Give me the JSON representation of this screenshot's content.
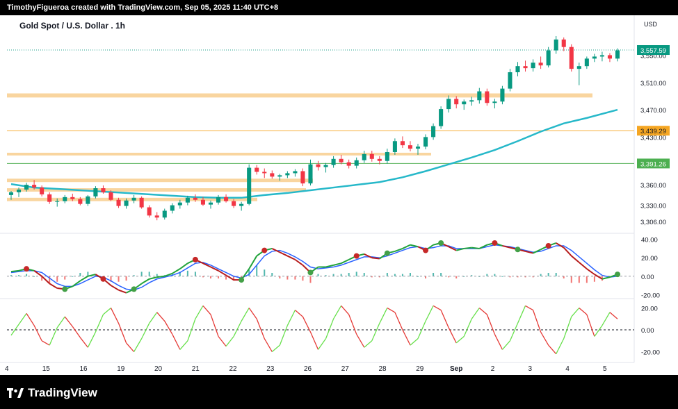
{
  "header": {
    "caption": "TimothyFigueroa created with TradingView.com, Sep 05, 2025 11:40 UTC+8"
  },
  "brand": {
    "name": "TradingView"
  },
  "chart_data": {
    "type": "candlestick",
    "title": "Gold Spot / U.S. Dollar . 1h",
    "currency": "USD",
    "x_labels": [
      "4",
      "15",
      "16",
      "19",
      "20",
      "21",
      "22",
      "23",
      "26",
      "27",
      "28",
      "29",
      "Sep",
      "2",
      "3",
      "4",
      "5"
    ],
    "y_ticks": [
      "3,550.00",
      "3,510.00",
      "3,470.00",
      "3,430.00",
      "3,390.00",
      "3,360.00",
      "3,330.00",
      "3,306.00"
    ],
    "ylim": [
      3295,
      3580
    ],
    "price_labels": [
      {
        "value": 3557.59,
        "text": "3,557.59",
        "color": "#089981"
      },
      {
        "value": 3439.29,
        "text": "3,439.29",
        "color": "#f5a623"
      },
      {
        "value": 3391.26,
        "text": "3,391.26",
        "color": "#4caf50"
      }
    ],
    "zones": [
      {
        "from": 3488,
        "to": 3494
      },
      {
        "from": 3403,
        "to": 3407
      },
      {
        "from": 3364,
        "to": 3369
      },
      {
        "from": 3350,
        "to": 3355
      },
      {
        "from": 3336,
        "to": 3341
      }
    ],
    "candles": [
      [
        3345,
        3351,
        3338,
        3349
      ],
      [
        3349,
        3356,
        3342,
        3353
      ],
      [
        3353,
        3363,
        3350,
        3360
      ],
      [
        3360,
        3367,
        3353,
        3356
      ],
      [
        3356,
        3359,
        3343,
        3346
      ],
      [
        3346,
        3349,
        3332,
        3335
      ],
      [
        3335,
        3340,
        3328,
        3336
      ],
      [
        3336,
        3345,
        3333,
        3342
      ],
      [
        3342,
        3347,
        3336,
        3339
      ],
      [
        3339,
        3342,
        3330,
        3332
      ],
      [
        3332,
        3345,
        3329,
        3343
      ],
      [
        3343,
        3358,
        3340,
        3355
      ],
      [
        3355,
        3359,
        3347,
        3349
      ],
      [
        3349,
        3352,
        3336,
        3338
      ],
      [
        3338,
        3341,
        3326,
        3329
      ],
      [
        3329,
        3340,
        3325,
        3337
      ],
      [
        3337,
        3345,
        3333,
        3341
      ],
      [
        3341,
        3343,
        3325,
        3327
      ],
      [
        3327,
        3330,
        3312,
        3315
      ],
      [
        3315,
        3320,
        3308,
        3312
      ],
      [
        3312,
        3325,
        3309,
        3322
      ],
      [
        3322,
        3333,
        3318,
        3330
      ],
      [
        3330,
        3338,
        3325,
        3334
      ],
      [
        3334,
        3344,
        3330,
        3341
      ],
      [
        3341,
        3346,
        3335,
        3338
      ],
      [
        3338,
        3342,
        3329,
        3331
      ],
      [
        3331,
        3337,
        3325,
        3334
      ],
      [
        3334,
        3345,
        3331,
        3342
      ],
      [
        3342,
        3346,
        3334,
        3336
      ],
      [
        3336,
        3339,
        3326,
        3329
      ],
      [
        3329,
        3335,
        3322,
        3332
      ],
      [
        3332,
        3390,
        3330,
        3385
      ],
      [
        3385,
        3389,
        3375,
        3379
      ],
      [
        3379,
        3384,
        3370,
        3377
      ],
      [
        3377,
        3381,
        3369,
        3372
      ],
      [
        3372,
        3376,
        3366,
        3374
      ],
      [
        3374,
        3380,
        3370,
        3377
      ],
      [
        3377,
        3383,
        3372,
        3380
      ],
      [
        3380,
        3384,
        3358,
        3362
      ],
      [
        3362,
        3397,
        3359,
        3390
      ],
      [
        3390,
        3395,
        3381,
        3386
      ],
      [
        3386,
        3392,
        3378,
        3389
      ],
      [
        3389,
        3402,
        3385,
        3398
      ],
      [
        3398,
        3404,
        3390,
        3393
      ],
      [
        3393,
        3397,
        3384,
        3388
      ],
      [
        3388,
        3400,
        3384,
        3396
      ],
      [
        3396,
        3410,
        3392,
        3405
      ],
      [
        3405,
        3410,
        3394,
        3398
      ],
      [
        3398,
        3402,
        3390,
        3395
      ],
      [
        3395,
        3413,
        3391,
        3408
      ],
      [
        3408,
        3428,
        3404,
        3424
      ],
      [
        3424,
        3431,
        3414,
        3418
      ],
      [
        3418,
        3424,
        3409,
        3413
      ],
      [
        3413,
        3420,
        3404,
        3416
      ],
      [
        3416,
        3434,
        3412,
        3430
      ],
      [
        3430,
        3450,
        3426,
        3446
      ],
      [
        3446,
        3475,
        3442,
        3471
      ],
      [
        3471,
        3491,
        3466,
        3486
      ],
      [
        3486,
        3490,
        3472,
        3478
      ],
      [
        3478,
        3485,
        3470,
        3482
      ],
      [
        3482,
        3489,
        3476,
        3484
      ],
      [
        3484,
        3502,
        3479,
        3497
      ],
      [
        3497,
        3501,
        3476,
        3480
      ],
      [
        3480,
        3486,
        3472,
        3482
      ],
      [
        3482,
        3505,
        3478,
        3501
      ],
      [
        3501,
        3530,
        3497,
        3525
      ],
      [
        3525,
        3540,
        3519,
        3534
      ],
      [
        3534,
        3542,
        3526,
        3531
      ],
      [
        3531,
        3544,
        3526,
        3539
      ],
      [
        3539,
        3548,
        3530,
        3535
      ],
      [
        3535,
        3562,
        3532,
        3557
      ],
      [
        3557,
        3578,
        3552,
        3573
      ],
      [
        3573,
        3576,
        3556,
        3562
      ],
      [
        3562,
        3566,
        3526,
        3530
      ],
      [
        3530,
        3539,
        3506,
        3534
      ],
      [
        3534,
        3548,
        3530,
        3545
      ],
      [
        3545,
        3552,
        3540,
        3548
      ],
      [
        3548,
        3555,
        3541,
        3550
      ],
      [
        3550,
        3553,
        3540,
        3545
      ],
      [
        3545,
        3560,
        3541,
        3557
      ]
    ],
    "moving_average": [
      [
        0,
        3361
      ],
      [
        3,
        3356
      ],
      [
        6,
        3354
      ],
      [
        9,
        3352
      ],
      [
        12,
        3350
      ],
      [
        15,
        3348
      ],
      [
        18,
        3346
      ],
      [
        21,
        3344
      ],
      [
        24,
        3342
      ],
      [
        27,
        3341
      ],
      [
        30,
        3341
      ],
      [
        33,
        3345
      ],
      [
        36,
        3348
      ],
      [
        39,
        3352
      ],
      [
        42,
        3356
      ],
      [
        45,
        3360
      ],
      [
        48,
        3364
      ],
      [
        51,
        3371
      ],
      [
        54,
        3380
      ],
      [
        57,
        3390
      ],
      [
        60,
        3400
      ],
      [
        63,
        3411
      ],
      [
        66,
        3424
      ],
      [
        69,
        3438
      ],
      [
        72,
        3450
      ],
      [
        75,
        3458
      ],
      [
        79,
        3470
      ]
    ],
    "macd": {
      "ylim": [
        -22,
        42
      ],
      "y_ticks": [
        "40.00",
        "20.00",
        "0.00",
        "-20.00"
      ],
      "macd_line": [
        5,
        6,
        8,
        6,
        0,
        -8,
        -13,
        -14,
        -11,
        -5,
        0,
        2,
        -3,
        -10,
        -15,
        -18,
        -14,
        -8,
        -3,
        -1,
        0,
        3,
        8,
        14,
        18,
        14,
        10,
        6,
        1,
        -4,
        -4,
        8,
        22,
        28,
        30,
        26,
        22,
        18,
        12,
        4,
        10,
        10,
        12,
        14,
        18,
        22,
        24,
        20,
        19,
        25,
        27,
        30,
        34,
        32,
        28,
        34,
        36,
        32,
        28,
        30,
        31,
        30,
        34,
        36,
        33,
        31,
        29,
        27,
        25,
        29,
        33,
        36,
        31,
        22,
        15,
        8,
        2,
        -3,
        -1,
        2
      ],
      "signal_line": [
        4,
        5,
        6,
        6,
        4,
        -2,
        -8,
        -11,
        -11,
        -8,
        -4,
        0,
        -1,
        -5,
        -10,
        -14,
        -15,
        -12,
        -7,
        -3,
        -1,
        1,
        4,
        9,
        14,
        15,
        12,
        8,
        4,
        0,
        -2,
        2,
        12,
        22,
        27,
        28,
        25,
        21,
        16,
        10,
        8,
        9,
        10,
        12,
        15,
        18,
        21,
        21,
        20,
        22,
        25,
        28,
        31,
        32,
        30,
        31,
        33,
        33,
        30,
        30,
        30,
        30,
        32,
        34,
        33,
        32,
        30,
        28,
        26,
        27,
        30,
        33,
        33,
        28,
        21,
        14,
        7,
        1,
        -1,
        0
      ],
      "markers": [
        {
          "i": 2,
          "type": "bear"
        },
        {
          "i": 7,
          "type": "bull"
        },
        {
          "i": 12,
          "type": "bear"
        },
        {
          "i": 16,
          "type": "bull"
        },
        {
          "i": 24,
          "type": "bear"
        },
        {
          "i": 30,
          "type": "bull"
        },
        {
          "i": 33,
          "type": "bear"
        },
        {
          "i": 39,
          "type": "bull"
        },
        {
          "i": 45,
          "type": "bear"
        },
        {
          "i": 49,
          "type": "bull"
        },
        {
          "i": 54,
          "type": "bear"
        },
        {
          "i": 56,
          "type": "bull"
        },
        {
          "i": 63,
          "type": "bear"
        },
        {
          "i": 66,
          "type": "bull"
        },
        {
          "i": 70,
          "type": "bear"
        },
        {
          "i": 79,
          "type": "bull"
        }
      ]
    },
    "oscillator": {
      "ylim": [
        -26,
        26
      ],
      "y_ticks": [
        "20.00",
        "0.00",
        "-20.00"
      ],
      "values": [
        -5,
        5,
        15,
        4,
        -10,
        -14,
        2,
        12,
        3,
        -7,
        -16,
        -2,
        14,
        20,
        6,
        -12,
        -20,
        -8,
        6,
        16,
        8,
        -4,
        -18,
        -10,
        10,
        22,
        14,
        -6,
        -15,
        -6,
        8,
        20,
        10,
        -8,
        -20,
        -14,
        4,
        18,
        12,
        -2,
        -18,
        -8,
        10,
        22,
        14,
        -4,
        -16,
        -10,
        6,
        20,
        16,
        0,
        -14,
        -8,
        8,
        22,
        18,
        2,
        -12,
        -6,
        10,
        20,
        14,
        -4,
        -18,
        -10,
        6,
        22,
        18,
        -2,
        -14,
        -22,
        -8,
        12,
        20,
        14,
        -6,
        4,
        16,
        10
      ]
    }
  }
}
